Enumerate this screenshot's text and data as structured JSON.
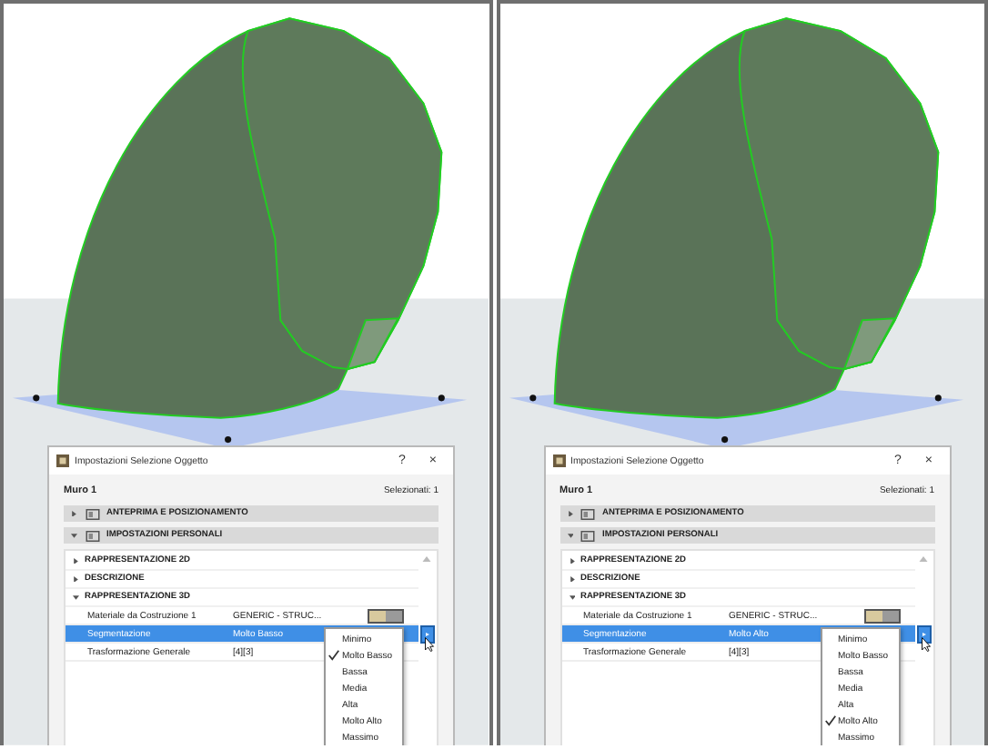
{
  "panels": [
    {
      "dialog": {
        "title": "Impostazioni Selezione Oggetto",
        "help": "?",
        "close": "×",
        "element_name": "Muro 1",
        "selected_count": "Selezionati: 1",
        "sections": [
          {
            "label": "ANTEPRIMA E POSIZIONAMENTO",
            "expanded": false
          },
          {
            "label": "IMPOSTAZIONI PERSONALI",
            "expanded": true
          }
        ],
        "groups": [
          {
            "label": "RAPPRESENTAZIONE 2D",
            "expanded": false
          },
          {
            "label": "DESCRIZIONE",
            "expanded": false
          },
          {
            "label": "RAPPRESENTAZIONE 3D",
            "expanded": true
          }
        ],
        "rows": [
          {
            "label": "Materiale da Costruzione 1",
            "value": "GENERIC - STRUC...",
            "kind": "material",
            "selected": false
          },
          {
            "label": "Segmentazione",
            "value": "Molto Basso",
            "kind": "dropdown",
            "selected": true
          },
          {
            "label": "Trasformazione Generale",
            "value": "[4][3]",
            "kind": "text",
            "selected": false
          }
        ],
        "dropdown_options": [
          {
            "label": "Minimo",
            "selected": false
          },
          {
            "label": "Molto Basso",
            "selected": true
          },
          {
            "label": "Bassa",
            "selected": false
          },
          {
            "label": "Media",
            "selected": false
          },
          {
            "label": "Alta",
            "selected": false
          },
          {
            "label": "Molto Alto",
            "selected": false
          },
          {
            "label": "Massimo",
            "selected": false
          }
        ]
      }
    },
    {
      "dialog": {
        "title": "Impostazioni Selezione Oggetto",
        "help": "?",
        "close": "×",
        "element_name": "Muro 1",
        "selected_count": "Selezionati: 1",
        "sections": [
          {
            "label": "ANTEPRIMA E POSIZIONAMENTO",
            "expanded": false
          },
          {
            "label": "IMPOSTAZIONI PERSONALI",
            "expanded": true
          }
        ],
        "groups": [
          {
            "label": "RAPPRESENTAZIONE 2D",
            "expanded": false
          },
          {
            "label": "DESCRIZIONE",
            "expanded": false
          },
          {
            "label": "RAPPRESENTAZIONE 3D",
            "expanded": true
          }
        ],
        "rows": [
          {
            "label": "Materiale da Costruzione 1",
            "value": "GENERIC - STRUC...",
            "kind": "material",
            "selected": false
          },
          {
            "label": "Segmentazione",
            "value": "Molto Alto",
            "kind": "dropdown",
            "selected": true
          },
          {
            "label": "Trasformazione Generale",
            "value": "[4][3]",
            "kind": "text",
            "selected": false
          }
        ],
        "dropdown_options": [
          {
            "label": "Minimo",
            "selected": false
          },
          {
            "label": "Molto Basso",
            "selected": false
          },
          {
            "label": "Bassa",
            "selected": false
          },
          {
            "label": "Media",
            "selected": false
          },
          {
            "label": "Alta",
            "selected": false
          },
          {
            "label": "Molto Alto",
            "selected": true
          },
          {
            "label": "Massimo",
            "selected": false
          }
        ]
      }
    }
  ]
}
